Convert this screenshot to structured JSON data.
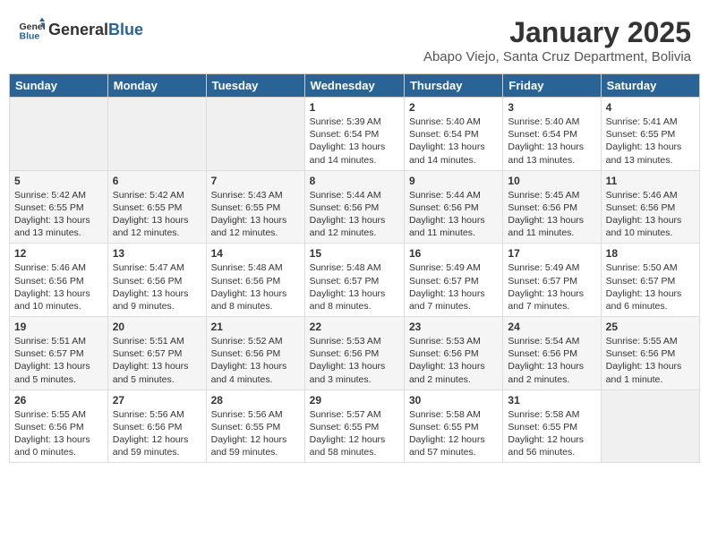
{
  "header": {
    "logo_general": "General",
    "logo_blue": "Blue",
    "month_title": "January 2025",
    "subtitle": "Abapo Viejo, Santa Cruz Department, Bolivia"
  },
  "days_of_week": [
    "Sunday",
    "Monday",
    "Tuesday",
    "Wednesday",
    "Thursday",
    "Friday",
    "Saturday"
  ],
  "weeks": [
    [
      {
        "day": "",
        "info": ""
      },
      {
        "day": "",
        "info": ""
      },
      {
        "day": "",
        "info": ""
      },
      {
        "day": "1",
        "info": "Sunrise: 5:39 AM\nSunset: 6:54 PM\nDaylight: 13 hours\nand 14 minutes."
      },
      {
        "day": "2",
        "info": "Sunrise: 5:40 AM\nSunset: 6:54 PM\nDaylight: 13 hours\nand 14 minutes."
      },
      {
        "day": "3",
        "info": "Sunrise: 5:40 AM\nSunset: 6:54 PM\nDaylight: 13 hours\nand 13 minutes."
      },
      {
        "day": "4",
        "info": "Sunrise: 5:41 AM\nSunset: 6:55 PM\nDaylight: 13 hours\nand 13 minutes."
      }
    ],
    [
      {
        "day": "5",
        "info": "Sunrise: 5:42 AM\nSunset: 6:55 PM\nDaylight: 13 hours\nand 13 minutes."
      },
      {
        "day": "6",
        "info": "Sunrise: 5:42 AM\nSunset: 6:55 PM\nDaylight: 13 hours\nand 12 minutes."
      },
      {
        "day": "7",
        "info": "Sunrise: 5:43 AM\nSunset: 6:55 PM\nDaylight: 13 hours\nand 12 minutes."
      },
      {
        "day": "8",
        "info": "Sunrise: 5:44 AM\nSunset: 6:56 PM\nDaylight: 13 hours\nand 12 minutes."
      },
      {
        "day": "9",
        "info": "Sunrise: 5:44 AM\nSunset: 6:56 PM\nDaylight: 13 hours\nand 11 minutes."
      },
      {
        "day": "10",
        "info": "Sunrise: 5:45 AM\nSunset: 6:56 PM\nDaylight: 13 hours\nand 11 minutes."
      },
      {
        "day": "11",
        "info": "Sunrise: 5:46 AM\nSunset: 6:56 PM\nDaylight: 13 hours\nand 10 minutes."
      }
    ],
    [
      {
        "day": "12",
        "info": "Sunrise: 5:46 AM\nSunset: 6:56 PM\nDaylight: 13 hours\nand 10 minutes."
      },
      {
        "day": "13",
        "info": "Sunrise: 5:47 AM\nSunset: 6:56 PM\nDaylight: 13 hours\nand 9 minutes."
      },
      {
        "day": "14",
        "info": "Sunrise: 5:48 AM\nSunset: 6:56 PM\nDaylight: 13 hours\nand 8 minutes."
      },
      {
        "day": "15",
        "info": "Sunrise: 5:48 AM\nSunset: 6:57 PM\nDaylight: 13 hours\nand 8 minutes."
      },
      {
        "day": "16",
        "info": "Sunrise: 5:49 AM\nSunset: 6:57 PM\nDaylight: 13 hours\nand 7 minutes."
      },
      {
        "day": "17",
        "info": "Sunrise: 5:49 AM\nSunset: 6:57 PM\nDaylight: 13 hours\nand 7 minutes."
      },
      {
        "day": "18",
        "info": "Sunrise: 5:50 AM\nSunset: 6:57 PM\nDaylight: 13 hours\nand 6 minutes."
      }
    ],
    [
      {
        "day": "19",
        "info": "Sunrise: 5:51 AM\nSunset: 6:57 PM\nDaylight: 13 hours\nand 5 minutes."
      },
      {
        "day": "20",
        "info": "Sunrise: 5:51 AM\nSunset: 6:57 PM\nDaylight: 13 hours\nand 5 minutes."
      },
      {
        "day": "21",
        "info": "Sunrise: 5:52 AM\nSunset: 6:56 PM\nDaylight: 13 hours\nand 4 minutes."
      },
      {
        "day": "22",
        "info": "Sunrise: 5:53 AM\nSunset: 6:56 PM\nDaylight: 13 hours\nand 3 minutes."
      },
      {
        "day": "23",
        "info": "Sunrise: 5:53 AM\nSunset: 6:56 PM\nDaylight: 13 hours\nand 2 minutes."
      },
      {
        "day": "24",
        "info": "Sunrise: 5:54 AM\nSunset: 6:56 PM\nDaylight: 13 hours\nand 2 minutes."
      },
      {
        "day": "25",
        "info": "Sunrise: 5:55 AM\nSunset: 6:56 PM\nDaylight: 13 hours\nand 1 minute."
      }
    ],
    [
      {
        "day": "26",
        "info": "Sunrise: 5:55 AM\nSunset: 6:56 PM\nDaylight: 13 hours\nand 0 minutes."
      },
      {
        "day": "27",
        "info": "Sunrise: 5:56 AM\nSunset: 6:56 PM\nDaylight: 12 hours\nand 59 minutes."
      },
      {
        "day": "28",
        "info": "Sunrise: 5:56 AM\nSunset: 6:55 PM\nDaylight: 12 hours\nand 59 minutes."
      },
      {
        "day": "29",
        "info": "Sunrise: 5:57 AM\nSunset: 6:55 PM\nDaylight: 12 hours\nand 58 minutes."
      },
      {
        "day": "30",
        "info": "Sunrise: 5:58 AM\nSunset: 6:55 PM\nDaylight: 12 hours\nand 57 minutes."
      },
      {
        "day": "31",
        "info": "Sunrise: 5:58 AM\nSunset: 6:55 PM\nDaylight: 12 hours\nand 56 minutes."
      },
      {
        "day": "",
        "info": ""
      }
    ]
  ]
}
